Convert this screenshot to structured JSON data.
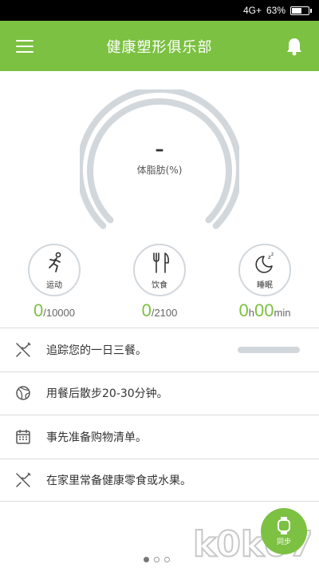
{
  "status_bar": {
    "left_text": "",
    "network": "4G+",
    "battery_percent": 63,
    "battery_text": "63%"
  },
  "header": {
    "title": "健康塑形俱乐部",
    "menu_icon": "hamburger-menu-icon",
    "notification_icon": "bell-icon"
  },
  "gauge": {
    "value": "–",
    "label": "体脂肪(%)",
    "track_color": "#d2d7dc"
  },
  "stats": [
    {
      "id": "exercise",
      "label": "运动",
      "icon": "running-person-icon",
      "value": "0",
      "target": "/10000"
    },
    {
      "id": "diet",
      "label": "饮食",
      "icon": "fork-knife-icon",
      "value": "0",
      "target": "/2100"
    },
    {
      "id": "sleep",
      "label": "睡眠",
      "icon": "moon-zzz-icon",
      "hours": "0",
      "hours_unit": "h",
      "minutes": "00",
      "minutes_unit": "min"
    }
  ],
  "list": [
    {
      "text": "追踪您的一日三餐。",
      "icon": "fork-knife-icon",
      "progress": 0
    },
    {
      "text": "用餐后散步20-30分钟。",
      "icon": "ball-icon"
    },
    {
      "text": "事先准备购物清单。",
      "icon": "calendar-icon"
    },
    {
      "text": "在家里常备健康零食或水果。",
      "icon": "fork-knife-icon"
    }
  ],
  "fab": {
    "label": "同步",
    "icon": "watch-icon"
  },
  "pager": {
    "count": 3,
    "active": 0
  },
  "watermark": {
    "text": "k0k07"
  },
  "colors": {
    "accent": "#7cc142",
    "gauge_track": "#d2d7dc",
    "text": "#333333"
  }
}
